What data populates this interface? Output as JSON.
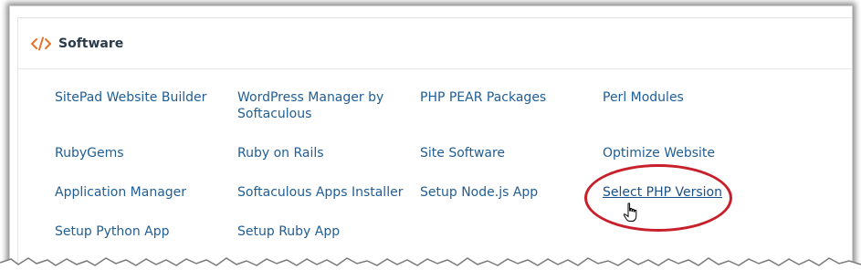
{
  "section": {
    "title": "Software",
    "icon": "code-icon"
  },
  "items": [
    [
      "SitePad Website Builder",
      "WordPress Manager by Softaculous",
      "PHP PEAR Packages",
      "Perl Modules"
    ],
    [
      "RubyGems",
      "Ruby on Rails",
      "Site Software",
      "Optimize Website"
    ],
    [
      "Application Manager",
      "Softaculous Apps Installer",
      "Setup Node.js App",
      "Select PHP Version"
    ],
    [
      "Setup Python App",
      "Setup Ruby App"
    ]
  ],
  "colors": {
    "link": "#1f5d94",
    "title": "#293a4a",
    "icon": "#e8722a",
    "highlight": "#c8202a"
  },
  "cursor_icon": "hand-pointer-icon"
}
